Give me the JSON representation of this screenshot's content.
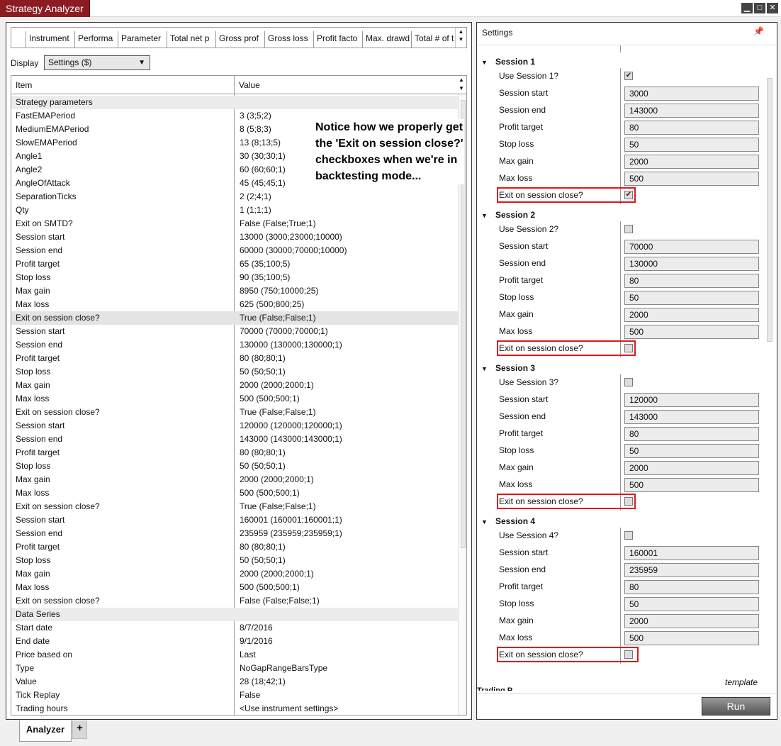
{
  "window": {
    "title": "Strategy Analyzer"
  },
  "grid_columns": [
    "Instrument",
    "Performa",
    "Parameter",
    "Total net p",
    "Gross prof",
    "Gross loss",
    "Profit facto",
    "Max. drawd",
    "Total # of t"
  ],
  "display": {
    "label": "Display",
    "value": "Settings ($)"
  },
  "prop_grid": {
    "col_item": "Item",
    "col_value": "Value",
    "rows": [
      {
        "name": "Strategy parameters",
        "value": "",
        "kind": "hdr"
      },
      {
        "name": "FastEMAPeriod",
        "value": "3 (3;5;2)"
      },
      {
        "name": "MediumEMAPeriod",
        "value": "8 (5;8;3)"
      },
      {
        "name": "SlowEMAPeriod",
        "value": "13 (8;13;5)"
      },
      {
        "name": "Angle1",
        "value": "30 (30;30;1)"
      },
      {
        "name": "Angle2",
        "value": "60 (60;60;1)"
      },
      {
        "name": "AngleOfAttack",
        "value": "45 (45;45;1)"
      },
      {
        "name": "SeparationTicks",
        "value": "2 (2;4;1)"
      },
      {
        "name": "Qty",
        "value": "1 (1;1;1)"
      },
      {
        "name": "Exit on SMTD?",
        "value": "False (False;True;1)"
      },
      {
        "name": "Session start",
        "value": "13000 (3000;23000;10000)"
      },
      {
        "name": "Session end",
        "value": "60000 (30000;70000;10000)"
      },
      {
        "name": "Profit target",
        "value": "65 (35;100;5)"
      },
      {
        "name": "Stop loss",
        "value": "90 (35;100;5)"
      },
      {
        "name": "Max gain",
        "value": "8950 (750;10000;25)"
      },
      {
        "name": "Max loss",
        "value": "625 (500;800;25)"
      },
      {
        "name": "Exit on session close?",
        "value": "True (False;False;1)",
        "kind": "sel"
      },
      {
        "name": "Session start",
        "value": "70000 (70000;70000;1)"
      },
      {
        "name": "Session end",
        "value": "130000 (130000;130000;1)"
      },
      {
        "name": "Profit target",
        "value": "80 (80;80;1)"
      },
      {
        "name": "Stop loss",
        "value": "50 (50;50;1)"
      },
      {
        "name": "Max gain",
        "value": "2000 (2000;2000;1)"
      },
      {
        "name": "Max loss",
        "value": "500 (500;500;1)"
      },
      {
        "name": "Exit on session close?",
        "value": "True (False;False;1)"
      },
      {
        "name": "Session start",
        "value": "120000 (120000;120000;1)"
      },
      {
        "name": "Session end",
        "value": "143000 (143000;143000;1)"
      },
      {
        "name": "Profit target",
        "value": "80 (80;80;1)"
      },
      {
        "name": "Stop loss",
        "value": "50 (50;50;1)"
      },
      {
        "name": "Max gain",
        "value": "2000 (2000;2000;1)"
      },
      {
        "name": "Max loss",
        "value": "500 (500;500;1)"
      },
      {
        "name": "Exit on session close?",
        "value": "True (False;False;1)"
      },
      {
        "name": "Session  start",
        "value": "160001 (160001;160001;1)"
      },
      {
        "name": "Session end",
        "value": "235959 (235959;235959;1)"
      },
      {
        "name": "Profit target",
        "value": "80 (80;80;1)"
      },
      {
        "name": "Stop loss",
        "value": "50 (50;50;1)"
      },
      {
        "name": "Max gain",
        "value": "2000 (2000;2000;1)"
      },
      {
        "name": "Max loss",
        "value": "500 (500;500;1)"
      },
      {
        "name": "Exit on session close?",
        "value": "False (False;False;1)"
      },
      {
        "name": "Data Series",
        "value": "",
        "kind": "hdr"
      },
      {
        "name": "Start date",
        "value": "8/7/2016"
      },
      {
        "name": "End date",
        "value": "9/1/2016"
      },
      {
        "name": "Price based on",
        "value": "Last"
      },
      {
        "name": "Type",
        "value": "NoGapRangeBarsType"
      },
      {
        "name": "Value",
        "value": "28 (18;42;1)"
      },
      {
        "name": "Tick Replay",
        "value": "False"
      },
      {
        "name": "Trading hours",
        "value": "<Use instrument settings>"
      }
    ]
  },
  "annotation": "Notice how we properly get the 'Exit on session close?' checkboxes when we're in backtesting mode...",
  "settings": {
    "title": "Settings",
    "template_label": "template",
    "run_label": "Run",
    "sessions": [
      {
        "title": "Session 1",
        "use_label": "Use Session 1?",
        "use_checked": true,
        "fields": [
          {
            "label": "Session start",
            "value": "3000"
          },
          {
            "label": "Session end",
            "value": "143000"
          },
          {
            "label": "Profit target",
            "value": "80"
          },
          {
            "label": "Stop loss",
            "value": "50"
          },
          {
            "label": "Max gain",
            "value": "2000"
          },
          {
            "label": "Max loss",
            "value": "500"
          }
        ],
        "exit_label": "Exit on session close?",
        "exit_checked": true
      },
      {
        "title": "Session 2",
        "use_label": "Use Session 2?",
        "use_checked": false,
        "fields": [
          {
            "label": "Session start",
            "value": "70000"
          },
          {
            "label": "Session end",
            "value": "130000"
          },
          {
            "label": "Profit target",
            "value": "80"
          },
          {
            "label": "Stop loss",
            "value": "50"
          },
          {
            "label": "Max gain",
            "value": "2000"
          },
          {
            "label": "Max loss",
            "value": "500"
          }
        ],
        "exit_label": "Exit on session close?",
        "exit_checked": false
      },
      {
        "title": "Session 3",
        "use_label": "Use Session 3?",
        "use_checked": false,
        "fields": [
          {
            "label": "Session start",
            "value": "120000"
          },
          {
            "label": "Session end",
            "value": "143000"
          },
          {
            "label": "Profit target",
            "value": "80"
          },
          {
            "label": "Stop loss",
            "value": "50"
          },
          {
            "label": "Max gain",
            "value": "2000"
          },
          {
            "label": "Max loss",
            "value": "500"
          }
        ],
        "exit_label": "Exit on session close?",
        "exit_checked": false
      },
      {
        "title": "Session 4",
        "use_label": "Use Session 4?",
        "use_checked": false,
        "fields": [
          {
            "label": "Session  start",
            "value": "160001"
          },
          {
            "label": "Session end",
            "value": "235959"
          },
          {
            "label": "Profit target",
            "value": "80"
          },
          {
            "label": "Stop loss",
            "value": "50"
          },
          {
            "label": "Max gain",
            "value": "2000"
          },
          {
            "label": "Max loss",
            "value": "500"
          }
        ],
        "exit_label": "Exit on session close?",
        "exit_checked": false
      }
    ],
    "next_section_stub": "Trading P"
  },
  "bottom_tabs": {
    "active": "Analyzer",
    "add": "+"
  },
  "colors": {
    "title_bg": "#8c1c22",
    "highlight": "#e01818",
    "run_btn": "#666666"
  },
  "icons": {
    "pin": "pin-icon",
    "minimize": "minimize-icon",
    "maximize": "maximize-icon",
    "close": "close-icon",
    "collapse": "triangle-down-icon",
    "check": "checkmark-icon"
  }
}
